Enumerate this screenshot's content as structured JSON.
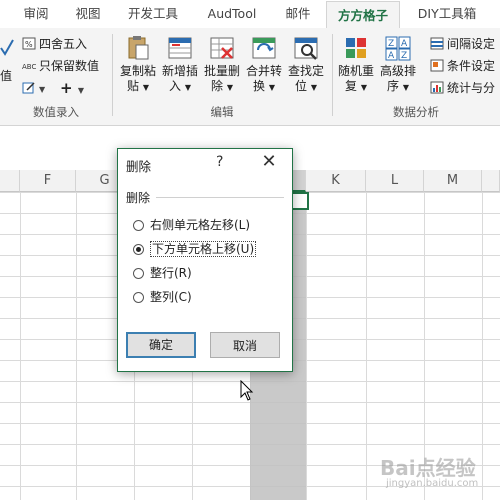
{
  "ribbon": {
    "tabs": [
      "审阅",
      "视图",
      "开发工具",
      "AudTool",
      "邮件",
      "方方格子",
      "DIY工具箱"
    ],
    "active_tab": "方方格子",
    "group_datainput": {
      "left_partial": "值",
      "round": "四舍五入",
      "keep_values": "只保留数值",
      "plus": "+",
      "label": "数值录入"
    },
    "group_edit": {
      "copy_paste": [
        "复制粘",
        "贴"
      ],
      "insert": [
        "新增插",
        "入"
      ],
      "batch_delete": [
        "批量删",
        "除"
      ],
      "merge": [
        "合并转",
        "换"
      ],
      "find": [
        "查找定",
        "位"
      ],
      "label": "编辑"
    },
    "group_analysis": {
      "random": [
        "随机重",
        "复"
      ],
      "sort": [
        "高级排",
        "序"
      ],
      "interval": "间隔设定",
      "conditional": "条件设定",
      "stats": "统计与分",
      "label": "数据分析"
    }
  },
  "sheet": {
    "columns": [
      "F",
      "G",
      "",
      "K",
      "L",
      "M"
    ],
    "selected_column": ""
  },
  "dialog": {
    "title": "删除",
    "help": "?",
    "close": "✕",
    "group_label": "删除",
    "options": [
      {
        "label": "右侧单元格左移(L)",
        "selected": false
      },
      {
        "label": "下方单元格上移(U)",
        "selected": true
      },
      {
        "label": "整行(R)",
        "selected": false
      },
      {
        "label": "整列(C)",
        "selected": false
      }
    ],
    "ok": "确定",
    "cancel": "取消"
  },
  "watermark": {
    "text": "Bai点经验",
    "url": "jingyan.baidu.com"
  }
}
